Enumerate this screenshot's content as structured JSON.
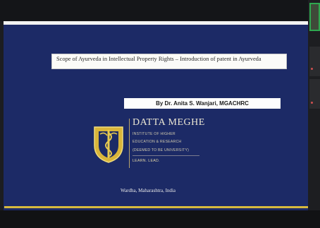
{
  "slide": {
    "title": "Scope of Ayurveda in Intellectual Property Rights – Introduction of patent in Ayurveda",
    "author": "By Dr. Anita S. Wanjari, MGACHRC",
    "logo": {
      "brand": "DATTA MEGHE",
      "line1": "INSTITUTE OF HIGHER",
      "line2": "EDUCATION & RESEARCH",
      "line3": "(DEEMED TO BE UNIVERSITY)",
      "tagline": "LEARN. LEAD."
    },
    "location": "Wardha, Maharashtra, India"
  },
  "colors": {
    "slide_background": "#1c2a66",
    "accent_gold": "#d7ba3e",
    "active_speaker_border": "#2fa84f"
  }
}
